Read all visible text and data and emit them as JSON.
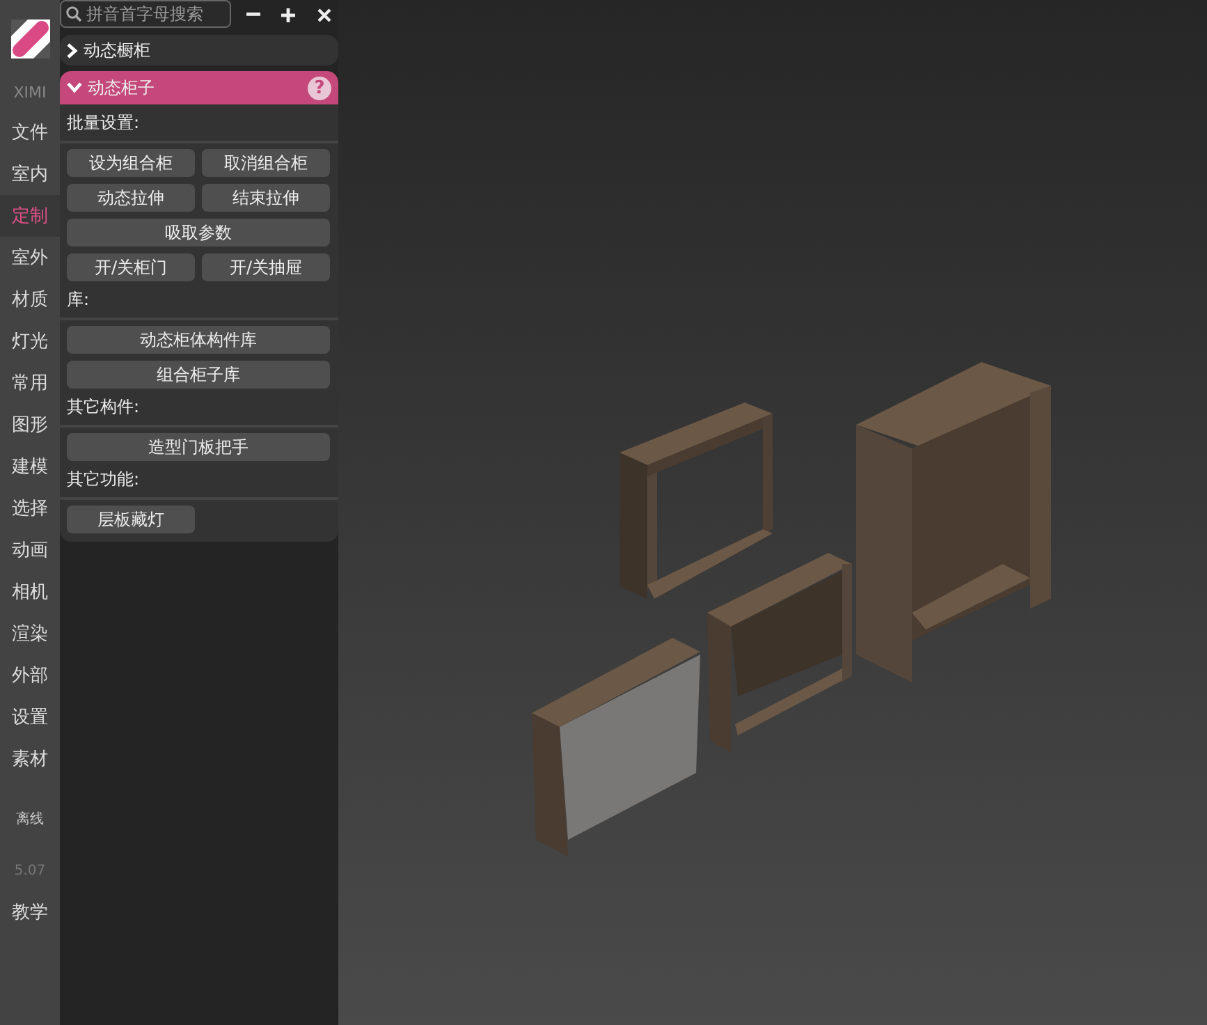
{
  "rail": {
    "items": [
      {
        "kind": "brand",
        "label": "XIMI",
        "selected": false
      },
      {
        "kind": "nav",
        "label": "文件",
        "selected": false
      },
      {
        "kind": "nav",
        "label": "室内",
        "selected": false
      },
      {
        "kind": "nav",
        "label": "定制",
        "selected": true
      },
      {
        "kind": "nav",
        "label": "室外",
        "selected": false
      },
      {
        "kind": "nav",
        "label": "材质",
        "selected": false
      },
      {
        "kind": "nav",
        "label": "灯光",
        "selected": false
      },
      {
        "kind": "nav",
        "label": "常用",
        "selected": false
      },
      {
        "kind": "nav",
        "label": "图形",
        "selected": false
      },
      {
        "kind": "nav",
        "label": "建模",
        "selected": false
      },
      {
        "kind": "nav",
        "label": "选择",
        "selected": false
      },
      {
        "kind": "nav",
        "label": "动画",
        "selected": false
      },
      {
        "kind": "nav",
        "label": "相机",
        "selected": false
      },
      {
        "kind": "nav",
        "label": "渲染",
        "selected": false
      },
      {
        "kind": "nav",
        "label": "外部",
        "selected": false
      },
      {
        "kind": "nav",
        "label": "设置",
        "selected": false
      },
      {
        "kind": "nav",
        "label": "素材",
        "selected": false
      },
      {
        "kind": "small",
        "label": "离线",
        "selected": false
      },
      {
        "kind": "version",
        "label": "5.07",
        "selected": false
      },
      {
        "kind": "nav",
        "label": "教学",
        "selected": false
      }
    ]
  },
  "panel": {
    "search": {
      "placeholder": "拼音首字母搜索"
    },
    "sections": [
      {
        "title": "动态橱柜",
        "expanded": false
      },
      {
        "title": "动态柜子",
        "expanded": true,
        "help": "?",
        "groups": [
          {
            "label": "批量设置:",
            "buttons": [
              {
                "label": "设为组合柜",
                "kind": "half"
              },
              {
                "label": "取消组合柜",
                "kind": "half"
              },
              {
                "label": "动态拉伸",
                "kind": "half"
              },
              {
                "label": "结束拉伸",
                "kind": "half"
              },
              {
                "label": "吸取参数",
                "kind": "full"
              },
              {
                "label": "开/关柜门",
                "kind": "half"
              },
              {
                "label": "开/关抽屉",
                "kind": "half"
              }
            ]
          },
          {
            "label": "库:",
            "buttons": [
              {
                "label": "动态柜体构件库",
                "kind": "full"
              },
              {
                "label": "组合柜子库",
                "kind": "full"
              }
            ]
          },
          {
            "label": "其它构件:",
            "buttons": [
              {
                "label": "造型门板把手",
                "kind": "full"
              }
            ]
          },
          {
            "label": "其它功能:",
            "buttons": [
              {
                "label": "层板藏灯",
                "kind": "half"
              }
            ]
          }
        ]
      }
    ]
  }
}
